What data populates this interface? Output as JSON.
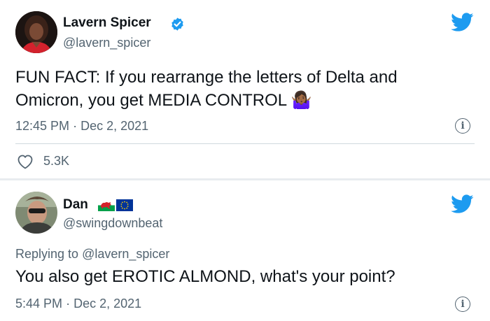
{
  "tweet1": {
    "author_name": "Lavern Spicer",
    "handle": "@lavern_spicer",
    "text_line1": "FUN FACT: If you rearrange the letters of Delta and",
    "text_line2": "Omicron, you get MEDIA CONTROL",
    "emoji": "🤷🏾‍♀️",
    "time": "12:45 PM",
    "separator": "·",
    "date": "Dec 2, 2021",
    "likes": "5.3K",
    "icons": [
      "verified-badge-icon",
      "twitter-bird-icon",
      "info-icon",
      "heart-icon"
    ]
  },
  "tweet2": {
    "author_name": "Dan",
    "flags": [
      "wales-flag-icon",
      "eu-flag-icon"
    ],
    "handle": "@swingdownbeat",
    "replying_prefix": "Replying to",
    "replying_to": "@lavern_spicer",
    "text": "You also get EROTIC ALMOND, what's your point?",
    "time": "5:44 PM",
    "separator": "·",
    "date": "Dec 2, 2021",
    "icons": [
      "twitter-bird-icon",
      "info-icon"
    ]
  },
  "colors": {
    "twitter_blue": "#1d9bf0",
    "text_primary": "#0f1419",
    "text_secondary": "#536471",
    "divider": "#cfd9de",
    "card_gap": "#e8ecef"
  }
}
